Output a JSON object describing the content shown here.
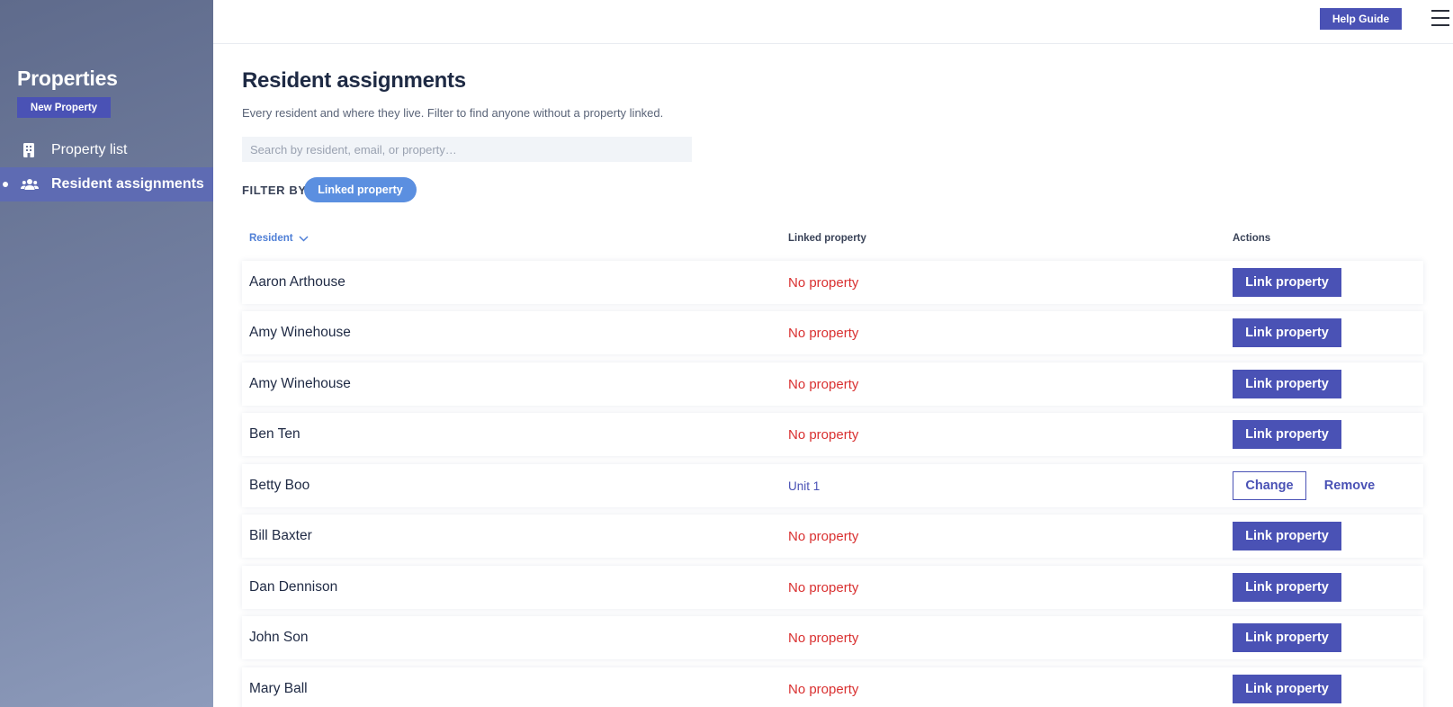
{
  "sidebar": {
    "title": "Properties",
    "new_button": "New Property",
    "items": [
      {
        "label": "Property list",
        "icon": "building-icon"
      },
      {
        "label": "Resident assignments",
        "icon": "users-icon",
        "active": true
      }
    ]
  },
  "topbar": {
    "help_label": "Help Guide",
    "menu_icon": "hamburger-menu-icon"
  },
  "main": {
    "title": "Resident assignments",
    "subtitle": "Every resident and where they live. Filter to find anyone without a property linked.",
    "search_placeholder": "Search by resident, email, or property…",
    "filter_label": "FILTER BY",
    "filter_chip": "Linked property",
    "columns": {
      "resident": "Resident",
      "linked_property": "Linked property",
      "actions": "Actions"
    },
    "rows": [
      {
        "resident": "Aaron Arthouse",
        "property": "No property",
        "action": "Link property"
      },
      {
        "resident": "Amy Winehouse",
        "property": "No property",
        "action": "Link property"
      },
      {
        "resident": "Amy Winehouse",
        "property": "No property",
        "action": "Link property"
      },
      {
        "resident": "Ben Ten",
        "property": "No property",
        "action": "Link property"
      },
      {
        "resident": "Betty Boo",
        "property": "Unit 1",
        "change": "Change",
        "remove": "Remove"
      },
      {
        "resident": "Bill Baxter",
        "property": "No property",
        "action": "Link property"
      },
      {
        "resident": "Dan Dennison",
        "property": "No property",
        "action": "Link property"
      },
      {
        "resident": "John Son",
        "property": "No property",
        "action": "Link property"
      },
      {
        "resident": "Mary Ball",
        "property": "No property",
        "action": "Link property"
      }
    ]
  },
  "colors": {
    "primary": "#4a52b5",
    "chip": "#5b8fe0",
    "no_property": "#d93030",
    "sort_header": "#4f7fd6"
  }
}
